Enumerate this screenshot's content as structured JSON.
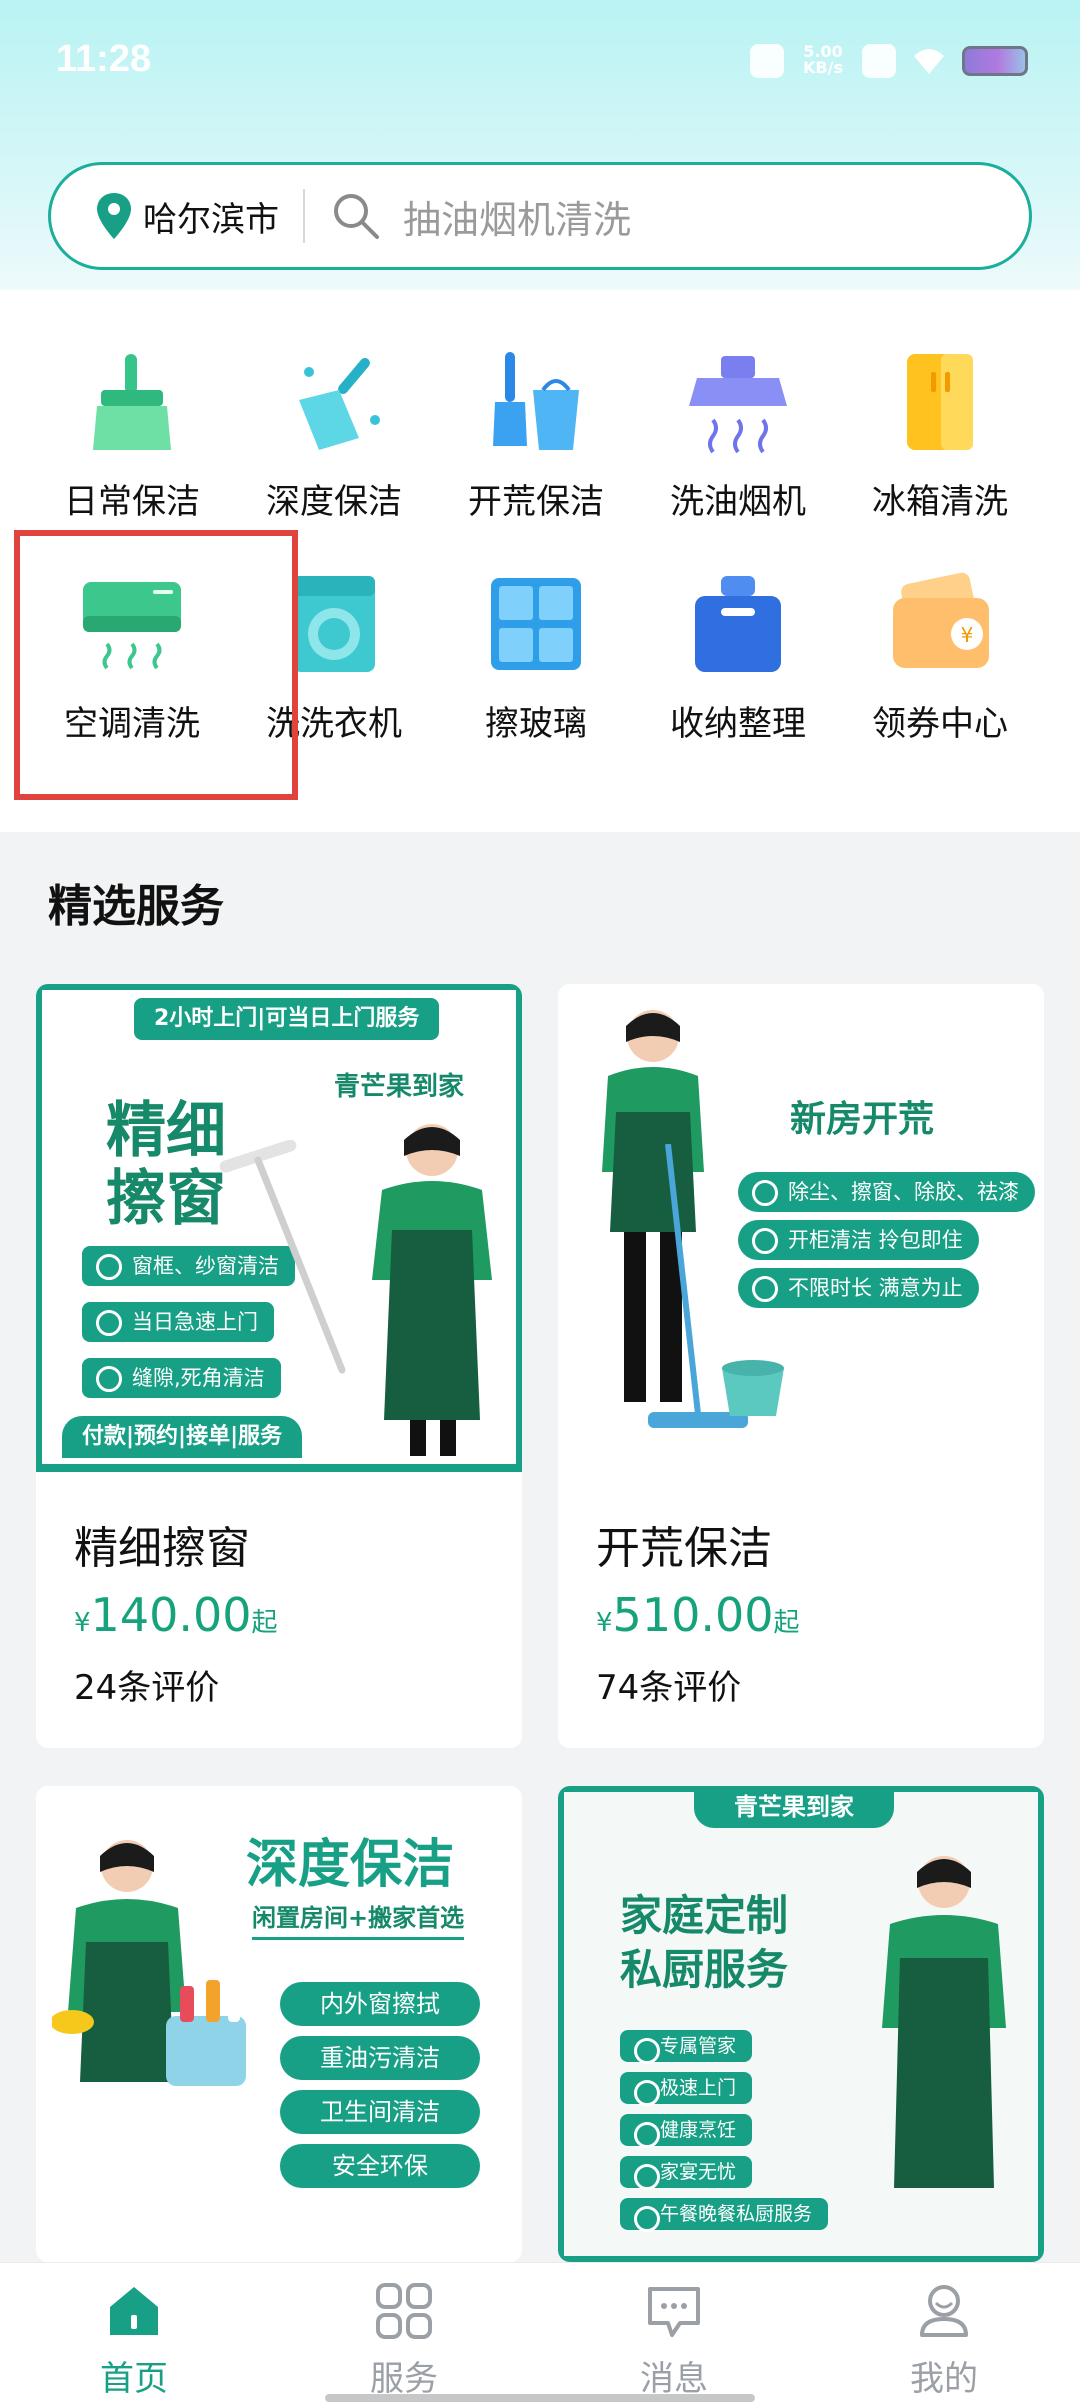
{
  "status_bar": {
    "time": "11:28",
    "network": "5.00 KB/s"
  },
  "search": {
    "city": "哈尔滨市",
    "placeholder": "抽油烟机清洗"
  },
  "categories": [
    {
      "label": "日常保洁",
      "icon": "broom-icon"
    },
    {
      "label": "深度保洁",
      "icon": "sparkle-broom-icon"
    },
    {
      "label": "开荒保洁",
      "icon": "brush-bucket-icon"
    },
    {
      "label": "洗油烟机",
      "icon": "range-hood-icon"
    },
    {
      "label": "冰箱清洗",
      "icon": "fridge-icon"
    },
    {
      "label": "空调清洗",
      "icon": "air-conditioner-icon"
    },
    {
      "label": "洗洗衣机",
      "icon": "washing-machine-icon"
    },
    {
      "label": "擦玻璃",
      "icon": "window-icon"
    },
    {
      "label": "收纳整理",
      "icon": "storage-box-icon"
    },
    {
      "label": "领券中心",
      "icon": "coupon-wallet-icon"
    }
  ],
  "section": {
    "title": "精选服务"
  },
  "cards": [
    {
      "title": "精细擦窗",
      "price": "140.00",
      "currency": "¥",
      "suffix": "起",
      "reviews": "24条评价",
      "promo": {
        "badge": "2小时上门|可当日上门服务",
        "brand": "青芒果到家",
        "headline1": "精细",
        "headline2": "擦窗",
        "checks": [
          "窗框、纱窗清洁",
          "当日急速上门",
          "缝隙,死角清洁"
        ],
        "footer": "付款|预约|接单|服务"
      }
    },
    {
      "title": "开荒保洁",
      "price": "510.00",
      "currency": "¥",
      "suffix": "起",
      "reviews": "74条评价",
      "promo": {
        "headline": "新房开荒",
        "checks": [
          "除尘、擦窗、除胶、祛漆",
          "开柜清洁 拎包即住",
          "不限时长 满意为止"
        ]
      }
    },
    {
      "promo": {
        "headline": "深度保洁",
        "sub": "闲置房间+搬家首选",
        "pills": [
          "内外窗擦拭",
          "重油污清洁",
          "卫生间清洁",
          "安全环保"
        ]
      }
    },
    {
      "promo": {
        "brand": "青芒果到家",
        "headline1": "家庭定制",
        "headline2": "私厨服务",
        "checks": [
          "专属管家",
          "极速上门",
          "健康烹饪",
          "家宴无忧",
          "午餐晚餐私厨服务"
        ]
      }
    }
  ],
  "bottom_nav": [
    {
      "label": "首页",
      "icon": "home-icon",
      "active": true
    },
    {
      "label": "服务",
      "icon": "grid-icon",
      "active": false
    },
    {
      "label": "消息",
      "icon": "message-icon",
      "active": false
    },
    {
      "label": "我的",
      "icon": "profile-icon",
      "active": false
    }
  ],
  "colors": {
    "brand": "#17a085",
    "highlight": "#e0433e"
  }
}
